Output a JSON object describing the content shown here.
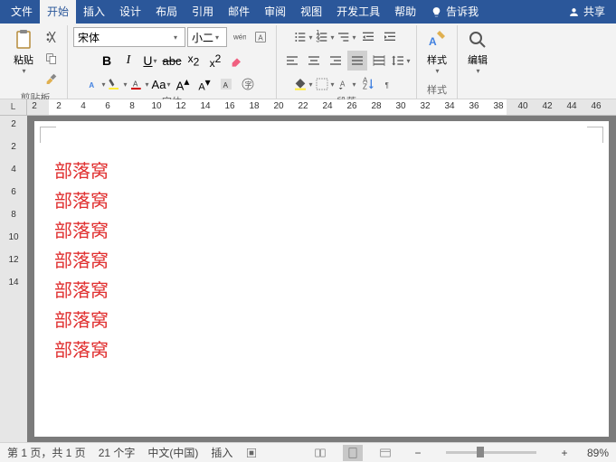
{
  "menu": {
    "file": "文件",
    "home": "开始",
    "insert": "插入",
    "design": "设计",
    "layout": "布局",
    "references": "引用",
    "mail": "邮件",
    "review": "审阅",
    "view": "视图",
    "developer": "开发工具",
    "help": "帮助",
    "tellme": "告诉我",
    "share": "共享"
  },
  "ribbon": {
    "clipboard": {
      "paste": "粘贴",
      "name": "剪贴板"
    },
    "font": {
      "name_input": "宋体",
      "size_input": "小二",
      "name": "字体"
    },
    "paragraph": {
      "name": "段落"
    },
    "styles": {
      "btn": "样式",
      "name": "样式"
    },
    "editing": {
      "btn": "编辑",
      "name": ""
    }
  },
  "ruler": {
    "corner": "L",
    "nums": [
      "2",
      "2",
      "4",
      "6",
      "8",
      "10",
      "12",
      "14",
      "16",
      "18",
      "20",
      "22",
      "24",
      "26",
      "28",
      "30",
      "32",
      "34",
      "36",
      "38",
      "40",
      "42",
      "44",
      "46"
    ]
  },
  "vruler": [
    "2",
    "2",
    "4",
    "6",
    "8",
    "10",
    "12",
    "14"
  ],
  "doc": {
    "lines": [
      "部落窝",
      "部落窝",
      "部落窝",
      "部落窝",
      "部落窝",
      "部落窝",
      "部落窝"
    ]
  },
  "status": {
    "page": "第 1 页，共 1 页",
    "words": "21 个字",
    "lang": "中文(中国)",
    "mode": "插入",
    "zoom": "89%"
  }
}
